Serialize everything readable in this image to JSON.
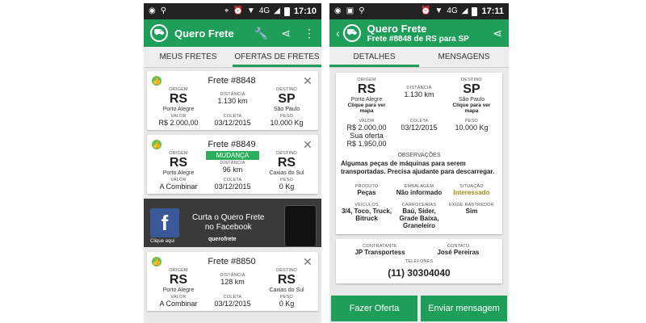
{
  "left": {
    "status": {
      "time": "17:10",
      "network": "4G"
    },
    "appbar": {
      "title": "Quero Frete"
    },
    "tabs": [
      {
        "label": "MEUS FRETES"
      },
      {
        "label": "OFERTAS DE FRETES"
      }
    ],
    "labels": {
      "origem": "ORIGEM",
      "destino": "DESTINO",
      "distancia": "DISTÂNCIA",
      "valor": "VALOR",
      "coleta": "COLETA",
      "peso": "PESO"
    },
    "cards": [
      {
        "title": "Frete #8848",
        "origin_code": "RS",
        "origin_city": "Porto Alegre",
        "distance": "1.130 km",
        "dest_code": "SP",
        "dest_city": "São Paulo",
        "value": "R$ 2.000,00",
        "pickup": "03/12/2015",
        "weight": "10.000 Kg"
      },
      {
        "title": "Frete #8849",
        "badge": "MUDANÇA",
        "origin_code": "RS",
        "origin_city": "Porto Alegre",
        "distance": "96 km",
        "dest_code": "RS",
        "dest_city": "Caxias do Sul",
        "value": "A Combinar",
        "pickup": "03/12/2015",
        "weight": "0 Kg"
      },
      {
        "title": "Frete #8850",
        "origin_code": "RS",
        "origin_city": "Porto Alegre",
        "distance": "128 km",
        "dest_code": "RS",
        "dest_city": "Caxias do Sul",
        "value": "A Combinar",
        "pickup": "03/12/2015",
        "weight": "0 Kg"
      }
    ],
    "banner": {
      "line1": "Curta o Quero Frete",
      "line2": "no Facebook",
      "click": "Clique aqui",
      "brand": "querofrete"
    }
  },
  "right": {
    "status": {
      "time": "17:11",
      "network": "4G"
    },
    "appbar": {
      "title": "Quero Frete",
      "subtitle": "Frete #8848 de RS para SP"
    },
    "tabs": [
      {
        "label": "DETALHES"
      },
      {
        "label": "MENSAGENS"
      }
    ],
    "detail": {
      "origem_label": "ORIGEM",
      "origin_code": "RS",
      "origin_city": "Porto Alegre",
      "origin_link": "Clique para ver mapa",
      "distancia_label": "DISTÂNCIA",
      "distance": "1.130 km",
      "destino_label": "DESTINO",
      "dest_code": "SP",
      "dest_city": "São Paulo",
      "dest_link": "Clique para ver mapa",
      "valor_label": "VALOR",
      "value": "R$ 2.000,00",
      "offer_label": "Sua oferta",
      "offer": "R$ 1.950,00",
      "coleta_label": "COLETA",
      "pickup": "03/12/2015",
      "peso_label": "PESO",
      "weight": "10.000 Kg",
      "obs_label": "OBSERVAÇÕES",
      "obs": "Algumas peças de máquinas para serem transportadas. Precisa ajudante para descarregar.",
      "produto_label": "PRODUTO",
      "produto": "Peças",
      "embalagem_label": "EMBALAGEM",
      "embalagem": "Não informado",
      "situacao_label": "SITUAÇÃO",
      "situacao": "Interessado",
      "veiculos_label": "VEÍCULOS",
      "veiculos": "3/4, Toco, Truck, Bitruck",
      "carrocerias_label": "CARROCERIAS",
      "carrocerias": "Baú, Sider, Grade Baixa, Graneleiro",
      "rastreador_label": "EXIGE RASTREDOR",
      "rastreador": "Sim"
    },
    "contact": {
      "contratante_label": "CONTRATANTE",
      "contratante": "JP Transportess",
      "contato_label": "CONTATO",
      "contato": "José Pereiras",
      "telefones_label": "TELEFONES",
      "phone": "(11) 30304040"
    },
    "buttons": {
      "offer": "Fazer Oferta",
      "message": "Enviar mensagem"
    }
  }
}
